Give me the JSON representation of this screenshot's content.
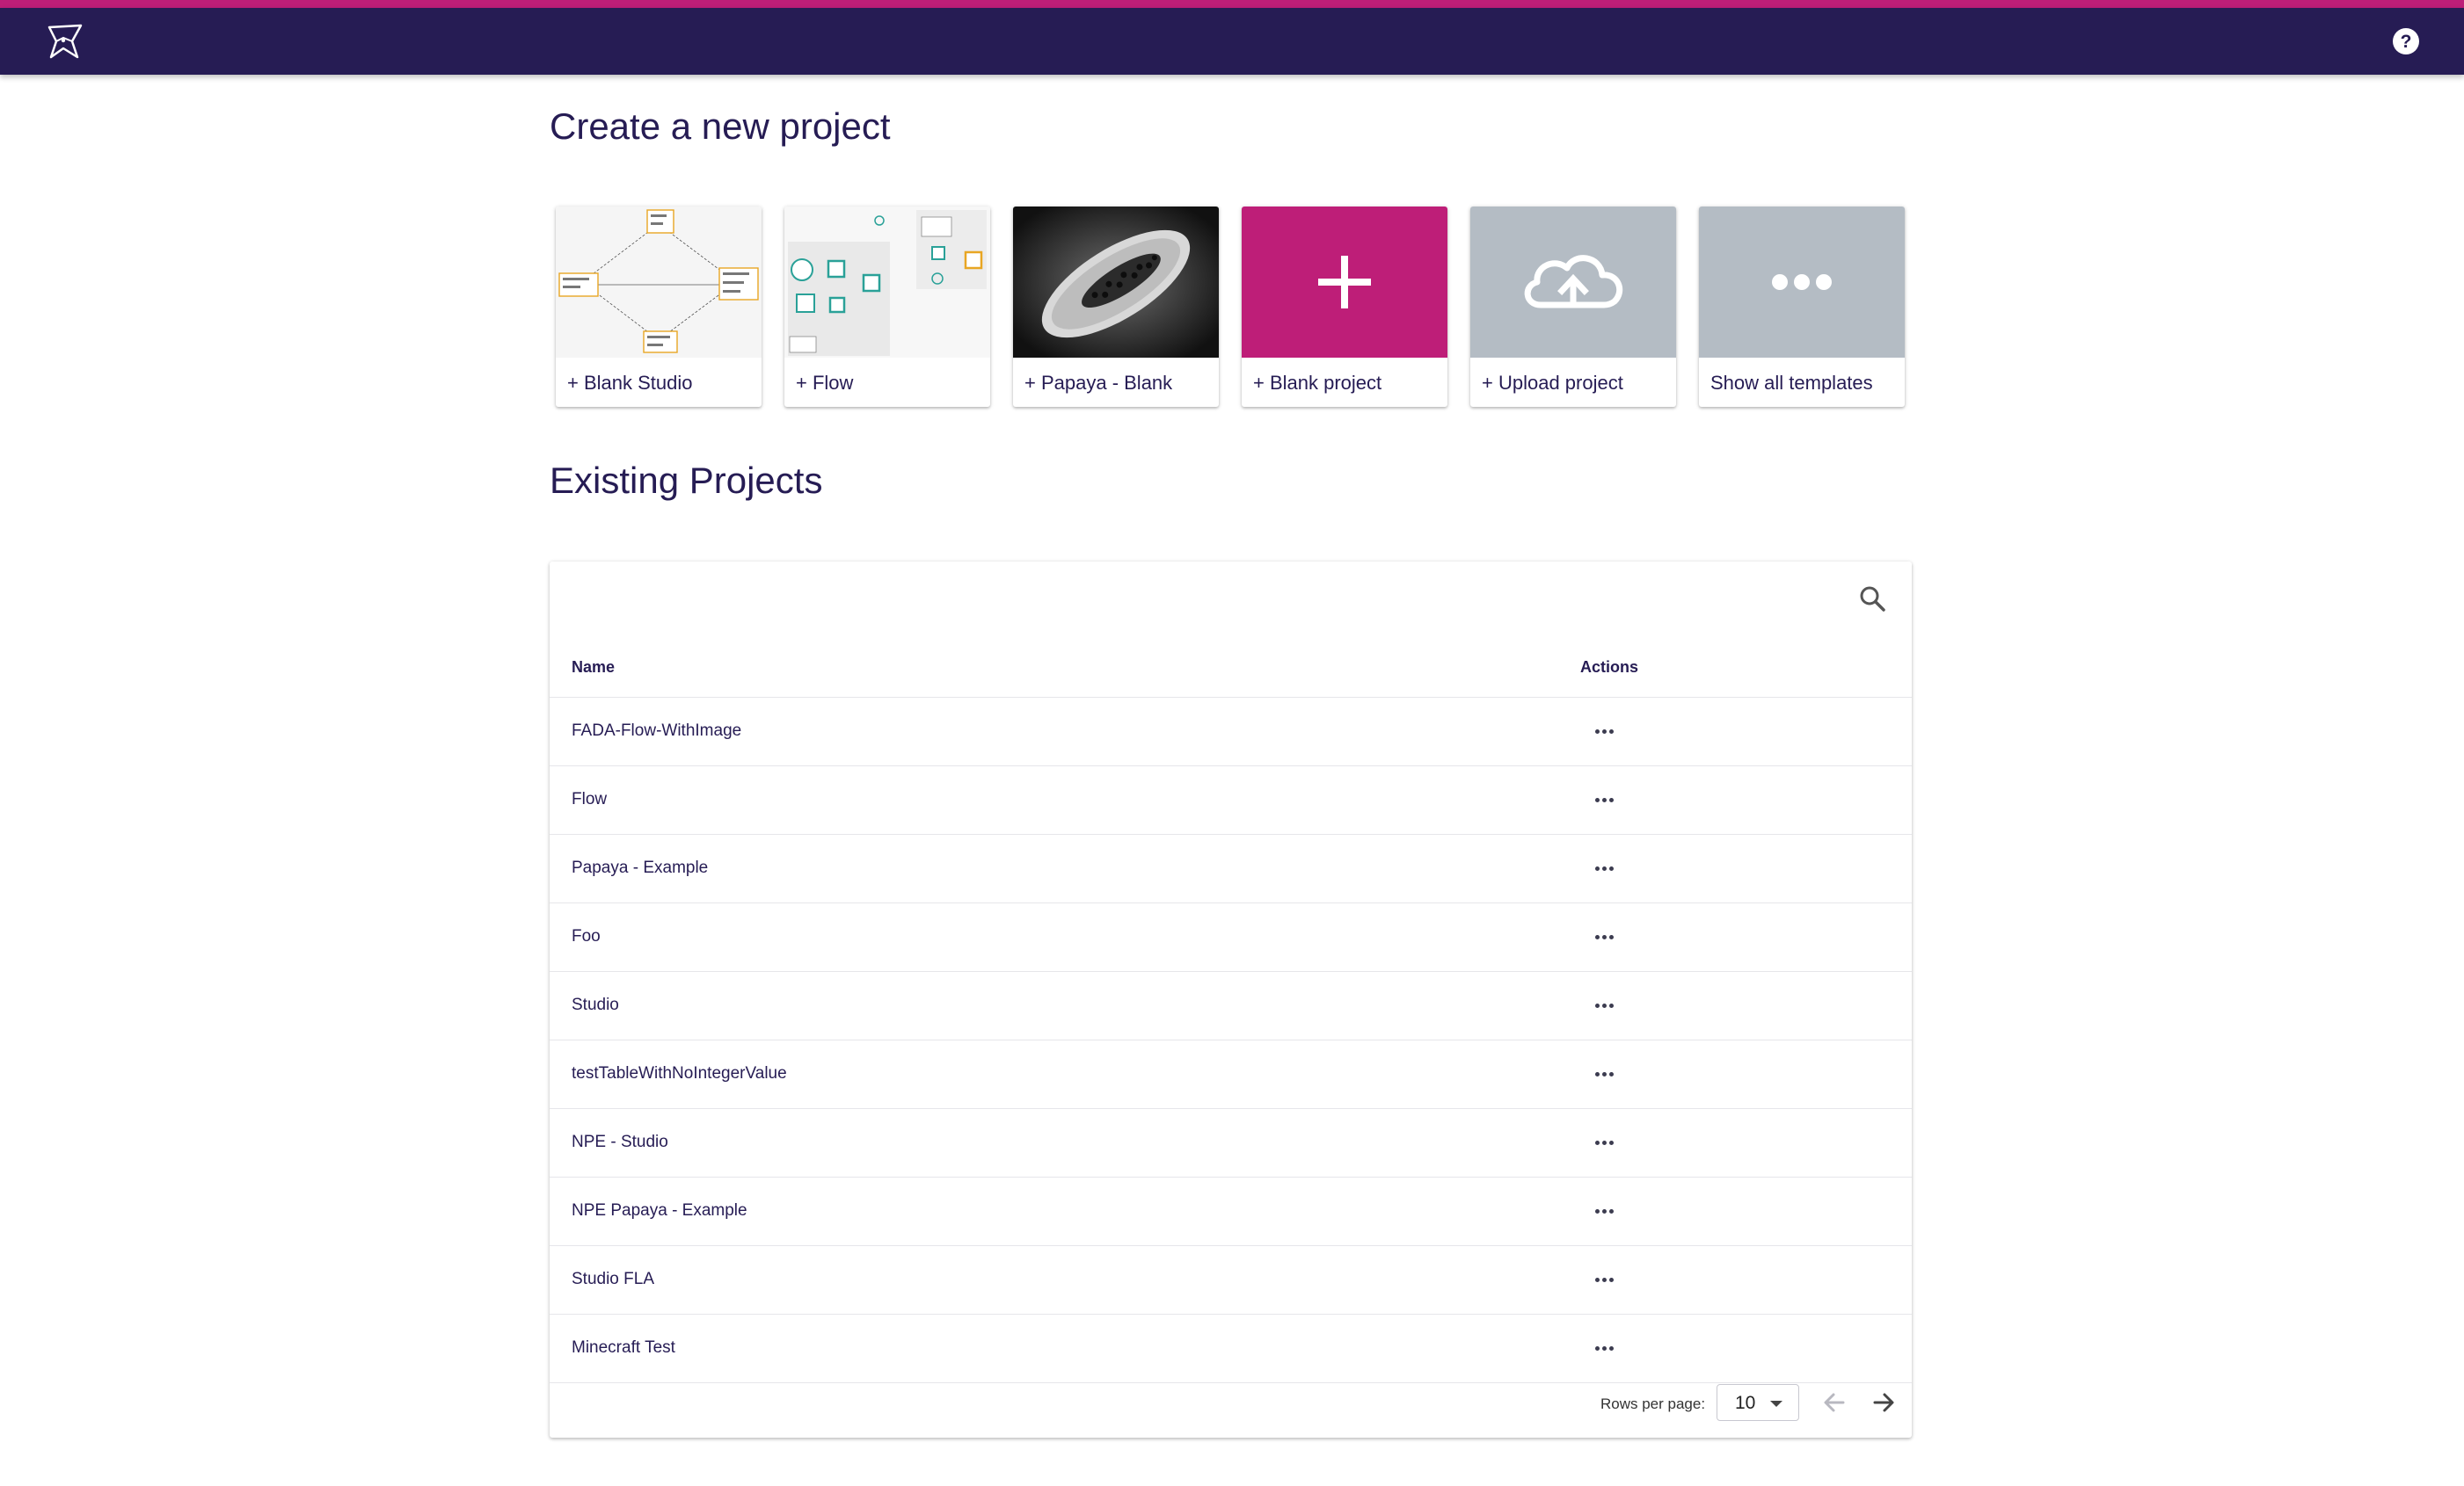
{
  "header": {
    "logo_icon": "studio-star-logo-icon",
    "help_icon": "help-circle-icon",
    "bar_color": "#261c54",
    "accent_color": "#be1e78"
  },
  "create": {
    "title": "Create a new project",
    "templates": [
      {
        "label": "+ Blank Studio",
        "thumbnail": "studio-diagram-thumbnail"
      },
      {
        "label": "+ Flow",
        "thumbnail": "flow-diagram-thumbnail"
      },
      {
        "label": "+ Papaya - Blank",
        "thumbnail": "papaya-photo-thumbnail"
      },
      {
        "label": "+ Blank project",
        "icon": "plus-icon",
        "color": "#be1e78"
      },
      {
        "label": "+ Upload project",
        "icon": "cloud-upload-icon",
        "color": "#b4bcc4"
      },
      {
        "label": "Show all templates",
        "icon": "more-horiz-icon",
        "color": "#b4bcc4"
      }
    ]
  },
  "existing": {
    "title": "Existing Projects",
    "search_icon": "search-icon",
    "columns": {
      "name": "Name",
      "actions": "Actions"
    },
    "rows": [
      {
        "name": "FADA-Flow-WithImage"
      },
      {
        "name": "Flow"
      },
      {
        "name": "Papaya - Example"
      },
      {
        "name": "Foo"
      },
      {
        "name": "Studio"
      },
      {
        "name": "testTableWithNoIntegerValue"
      },
      {
        "name": "NPE - Studio"
      },
      {
        "name": "NPE Papaya - Example"
      },
      {
        "name": "Studio FLA"
      },
      {
        "name": "Minecraft Test"
      }
    ],
    "row_action_icon": "more-horiz-icon",
    "pagination": {
      "rows_per_page_label": "Rows per page:",
      "rows_per_page": "10",
      "prev_icon": "arrow-left-icon",
      "next_icon": "arrow-right-icon"
    }
  }
}
